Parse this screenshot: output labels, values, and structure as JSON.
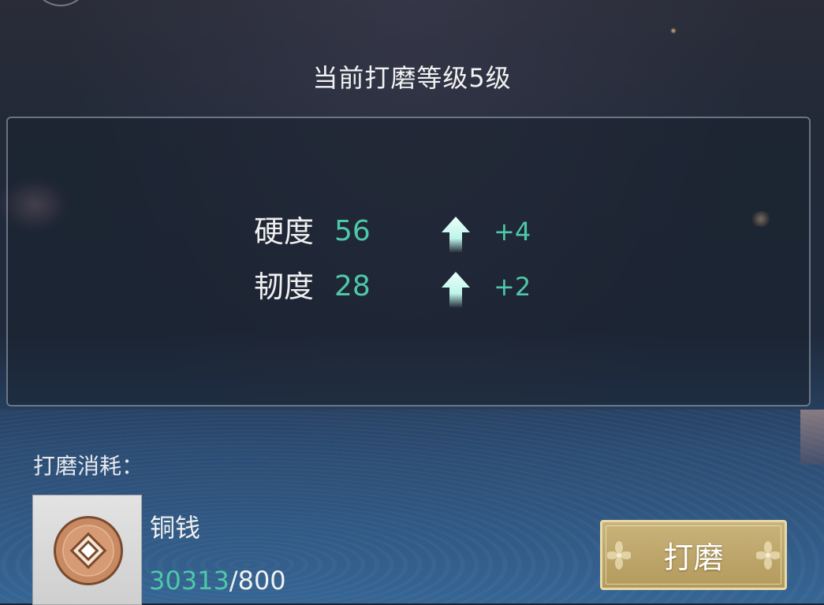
{
  "header": {
    "title": "当前打磨等级5级"
  },
  "stats": [
    {
      "name": "硬度",
      "value": "56",
      "delta": "+4",
      "icon": "up-arrow-icon"
    },
    {
      "name": "韧度",
      "value": "28",
      "delta": "+2",
      "icon": "up-arrow-icon"
    }
  ],
  "cost": {
    "label": "打磨消耗：",
    "item": {
      "name": "铜钱",
      "icon": "copper-coin-icon",
      "have": "30313",
      "separator": "/",
      "need": "800"
    }
  },
  "actions": {
    "polish_label": "打磨"
  },
  "colors": {
    "accent_green": "#4ec8a8",
    "button_gold": "#c9b37a",
    "text_white": "#f0f0f0"
  }
}
